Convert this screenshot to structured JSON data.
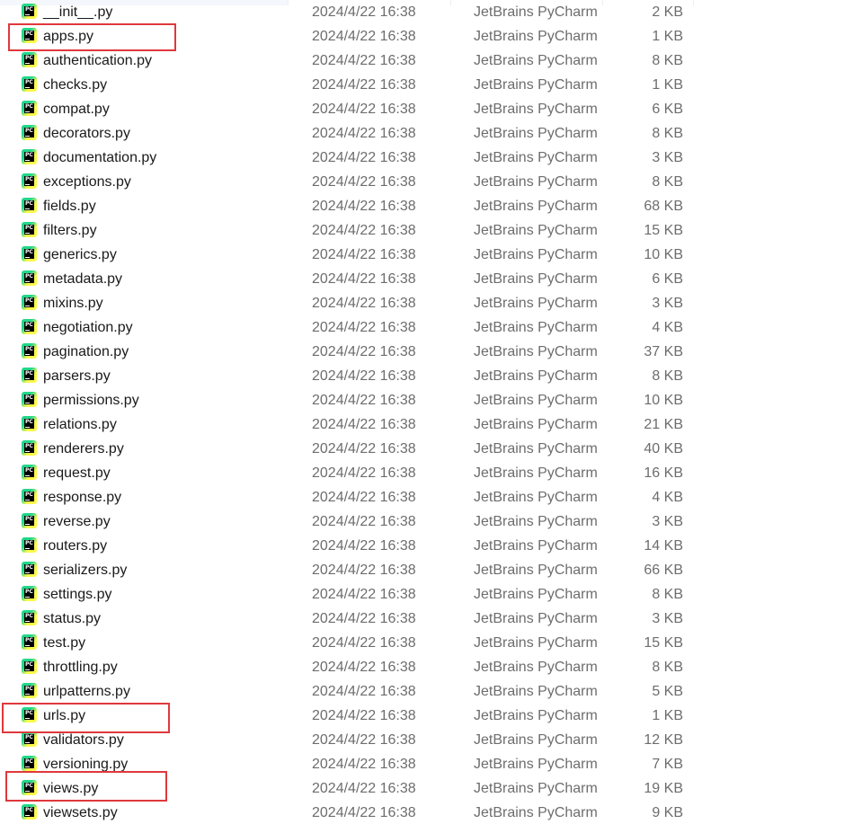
{
  "files": [
    {
      "name": "__init__.py",
      "modified": "2024/4/22 16:38",
      "type": "JetBrains PyCharm",
      "size": "2 KB"
    },
    {
      "name": "apps.py",
      "modified": "2024/4/22 16:38",
      "type": "JetBrains PyCharm",
      "size": "1 KB"
    },
    {
      "name": "authentication.py",
      "modified": "2024/4/22 16:38",
      "type": "JetBrains PyCharm",
      "size": "8 KB"
    },
    {
      "name": "checks.py",
      "modified": "2024/4/22 16:38",
      "type": "JetBrains PyCharm",
      "size": "1 KB"
    },
    {
      "name": "compat.py",
      "modified": "2024/4/22 16:38",
      "type": "JetBrains PyCharm",
      "size": "6 KB"
    },
    {
      "name": "decorators.py",
      "modified": "2024/4/22 16:38",
      "type": "JetBrains PyCharm",
      "size": "8 KB"
    },
    {
      "name": "documentation.py",
      "modified": "2024/4/22 16:38",
      "type": "JetBrains PyCharm",
      "size": "3 KB"
    },
    {
      "name": "exceptions.py",
      "modified": "2024/4/22 16:38",
      "type": "JetBrains PyCharm",
      "size": "8 KB"
    },
    {
      "name": "fields.py",
      "modified": "2024/4/22 16:38",
      "type": "JetBrains PyCharm",
      "size": "68 KB"
    },
    {
      "name": "filters.py",
      "modified": "2024/4/22 16:38",
      "type": "JetBrains PyCharm",
      "size": "15 KB"
    },
    {
      "name": "generics.py",
      "modified": "2024/4/22 16:38",
      "type": "JetBrains PyCharm",
      "size": "10 KB"
    },
    {
      "name": "metadata.py",
      "modified": "2024/4/22 16:38",
      "type": "JetBrains PyCharm",
      "size": "6 KB"
    },
    {
      "name": "mixins.py",
      "modified": "2024/4/22 16:38",
      "type": "JetBrains PyCharm",
      "size": "3 KB"
    },
    {
      "name": "negotiation.py",
      "modified": "2024/4/22 16:38",
      "type": "JetBrains PyCharm",
      "size": "4 KB"
    },
    {
      "name": "pagination.py",
      "modified": "2024/4/22 16:38",
      "type": "JetBrains PyCharm",
      "size": "37 KB"
    },
    {
      "name": "parsers.py",
      "modified": "2024/4/22 16:38",
      "type": "JetBrains PyCharm",
      "size": "8 KB"
    },
    {
      "name": "permissions.py",
      "modified": "2024/4/22 16:38",
      "type": "JetBrains PyCharm",
      "size": "10 KB"
    },
    {
      "name": "relations.py",
      "modified": "2024/4/22 16:38",
      "type": "JetBrains PyCharm",
      "size": "21 KB"
    },
    {
      "name": "renderers.py",
      "modified": "2024/4/22 16:38",
      "type": "JetBrains PyCharm",
      "size": "40 KB"
    },
    {
      "name": "request.py",
      "modified": "2024/4/22 16:38",
      "type": "JetBrains PyCharm",
      "size": "16 KB"
    },
    {
      "name": "response.py",
      "modified": "2024/4/22 16:38",
      "type": "JetBrains PyCharm",
      "size": "4 KB"
    },
    {
      "name": "reverse.py",
      "modified": "2024/4/22 16:38",
      "type": "JetBrains PyCharm",
      "size": "3 KB"
    },
    {
      "name": "routers.py",
      "modified": "2024/4/22 16:38",
      "type": "JetBrains PyCharm",
      "size": "14 KB"
    },
    {
      "name": "serializers.py",
      "modified": "2024/4/22 16:38",
      "type": "JetBrains PyCharm",
      "size": "66 KB"
    },
    {
      "name": "settings.py",
      "modified": "2024/4/22 16:38",
      "type": "JetBrains PyCharm",
      "size": "8 KB"
    },
    {
      "name": "status.py",
      "modified": "2024/4/22 16:38",
      "type": "JetBrains PyCharm",
      "size": "3 KB"
    },
    {
      "name": "test.py",
      "modified": "2024/4/22 16:38",
      "type": "JetBrains PyCharm",
      "size": "15 KB"
    },
    {
      "name": "throttling.py",
      "modified": "2024/4/22 16:38",
      "type": "JetBrains PyCharm",
      "size": "8 KB"
    },
    {
      "name": "urlpatterns.py",
      "modified": "2024/4/22 16:38",
      "type": "JetBrains PyCharm",
      "size": "5 KB"
    },
    {
      "name": "urls.py",
      "modified": "2024/4/22 16:38",
      "type": "JetBrains PyCharm",
      "size": "1 KB"
    },
    {
      "name": "validators.py",
      "modified": "2024/4/22 16:38",
      "type": "JetBrains PyCharm",
      "size": "12 KB"
    },
    {
      "name": "versioning.py",
      "modified": "2024/4/22 16:38",
      "type": "JetBrains PyCharm",
      "size": "7 KB"
    },
    {
      "name": "views.py",
      "modified": "2024/4/22 16:38",
      "type": "JetBrains PyCharm",
      "size": "19 KB"
    },
    {
      "name": "viewsets.py",
      "modified": "2024/4/22 16:38",
      "type": "JetBrains PyCharm",
      "size": "9 KB"
    }
  ],
  "file_icon": {
    "name": "pycharm-file-icon",
    "label": "PC"
  },
  "colors": {
    "highlight_border": "#e0383c",
    "icon_green": "#21d789",
    "icon_yellow": "#fcf84a",
    "secondary_text": "#6d6d6d"
  }
}
